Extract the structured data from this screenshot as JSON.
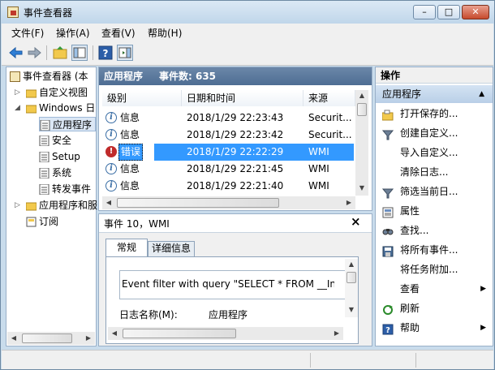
{
  "window": {
    "title": "事件查看器",
    "btn_min": "–",
    "btn_max": "□",
    "btn_close": "✕"
  },
  "menu": [
    "文件(F)",
    "操作(A)",
    "查看(V)",
    "帮助(H)"
  ],
  "tree": {
    "root": "事件查看器 (本",
    "items": [
      {
        "label": "自定义视图",
        "icon": "folder-icon"
      },
      {
        "label": "Windows 日",
        "icon": "folder-icon"
      },
      {
        "label": "应用程序",
        "icon": "log-icon"
      },
      {
        "label": "安全",
        "icon": "log-icon"
      },
      {
        "label": "Setup",
        "icon": "log-icon"
      },
      {
        "label": "系统",
        "icon": "log-icon"
      },
      {
        "label": "转发事件",
        "icon": "log-icon"
      },
      {
        "label": "应用程序和服",
        "icon": "folder-icon"
      },
      {
        "label": "订阅",
        "icon": "subscription-icon"
      }
    ]
  },
  "events": {
    "header_title": "应用程序",
    "header_count": "事件数: 635",
    "columns": [
      "级别",
      "日期和时间",
      "来源"
    ],
    "rows": [
      {
        "level": "信息",
        "datetime": "2018/1/29 22:23:43",
        "source": "Securit...",
        "type": "info"
      },
      {
        "level": "信息",
        "datetime": "2018/1/29 22:23:42",
        "source": "Securit...",
        "type": "info"
      },
      {
        "level": "错误",
        "datetime": "2018/1/29 22:22:29",
        "source": "WMI",
        "type": "error"
      },
      {
        "level": "信息",
        "datetime": "2018/1/29 22:21:45",
        "source": "WMI",
        "type": "info"
      },
      {
        "level": "信息",
        "datetime": "2018/1/29 22:21:40",
        "source": "WMI",
        "type": "info"
      }
    ]
  },
  "details": {
    "title": "事件 10，WMI",
    "close": "×",
    "tabs": [
      "常规",
      "详细信息"
    ],
    "message": "Event filter with query \"SELECT * FROM __Instan",
    "log_name_label": "日志名称(M):",
    "log_name_value": "应用程序"
  },
  "actions": {
    "header": "操作",
    "section": "应用程序",
    "items": [
      {
        "label": "打开保存的...",
        "icon": "open-folder-icon"
      },
      {
        "label": "创建自定义...",
        "icon": "filter-icon"
      },
      {
        "label": "导入自定义...",
        "icon": ""
      },
      {
        "label": "清除日志...",
        "icon": ""
      },
      {
        "label": "筛选当前日...",
        "icon": "filter-icon"
      },
      {
        "label": "属性",
        "icon": "properties-icon"
      },
      {
        "label": "查找...",
        "icon": "find-icon"
      },
      {
        "label": "将所有事件...",
        "icon": "save-icon"
      },
      {
        "label": "将任务附加...",
        "icon": ""
      },
      {
        "label": "查看",
        "icon": "",
        "submenu": true
      },
      {
        "label": "刷新",
        "icon": "refresh-icon"
      },
      {
        "label": "帮助",
        "icon": "help-icon",
        "submenu": true
      }
    ]
  },
  "colors": {
    "selection": "#3399ff",
    "header": "#5a7aa0",
    "error": "#c02b2b",
    "frame": "#c9dcec"
  }
}
